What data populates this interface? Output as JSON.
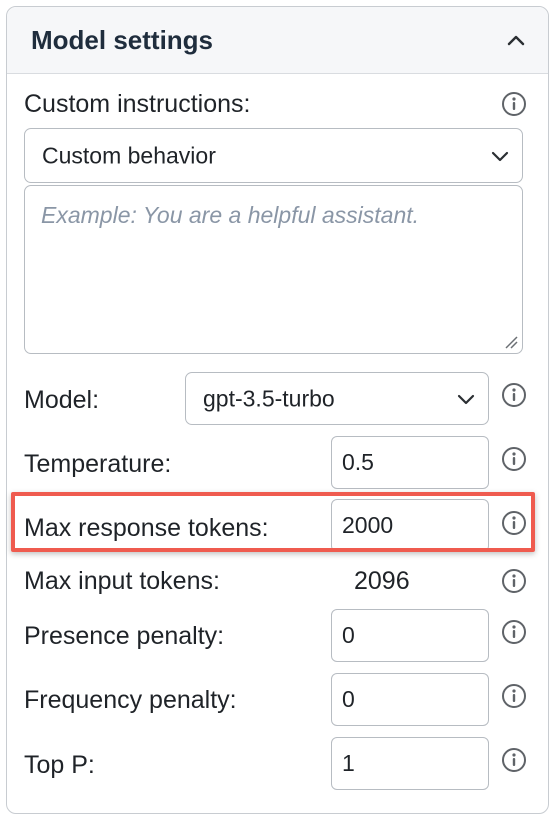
{
  "panel": {
    "title": "Model settings"
  },
  "custom_instructions": {
    "label": "Custom instructions:",
    "selected": "Custom behavior",
    "placeholder": "Example: You are a helpful assistant."
  },
  "model": {
    "label": "Model:",
    "selected": "gpt-3.5-turbo"
  },
  "temperature": {
    "label": "Temperature:",
    "value": "0.5"
  },
  "max_response_tokens": {
    "label": "Max response tokens:",
    "value": "2000"
  },
  "max_input_tokens": {
    "label": "Max input tokens:",
    "value": "2096"
  },
  "presence_penalty": {
    "label": "Presence penalty:",
    "value": "0"
  },
  "frequency_penalty": {
    "label": "Frequency penalty:",
    "value": "0"
  },
  "top_p": {
    "label": "Top P:",
    "value": "1"
  },
  "colors": {
    "highlight": "#ef5b4f",
    "border": "#b7bcc2",
    "placeholder": "#8a96a6"
  },
  "icons": [
    "chevron-up-icon",
    "info-icon",
    "chevron-down-icon",
    "resize-grip-icon"
  ]
}
